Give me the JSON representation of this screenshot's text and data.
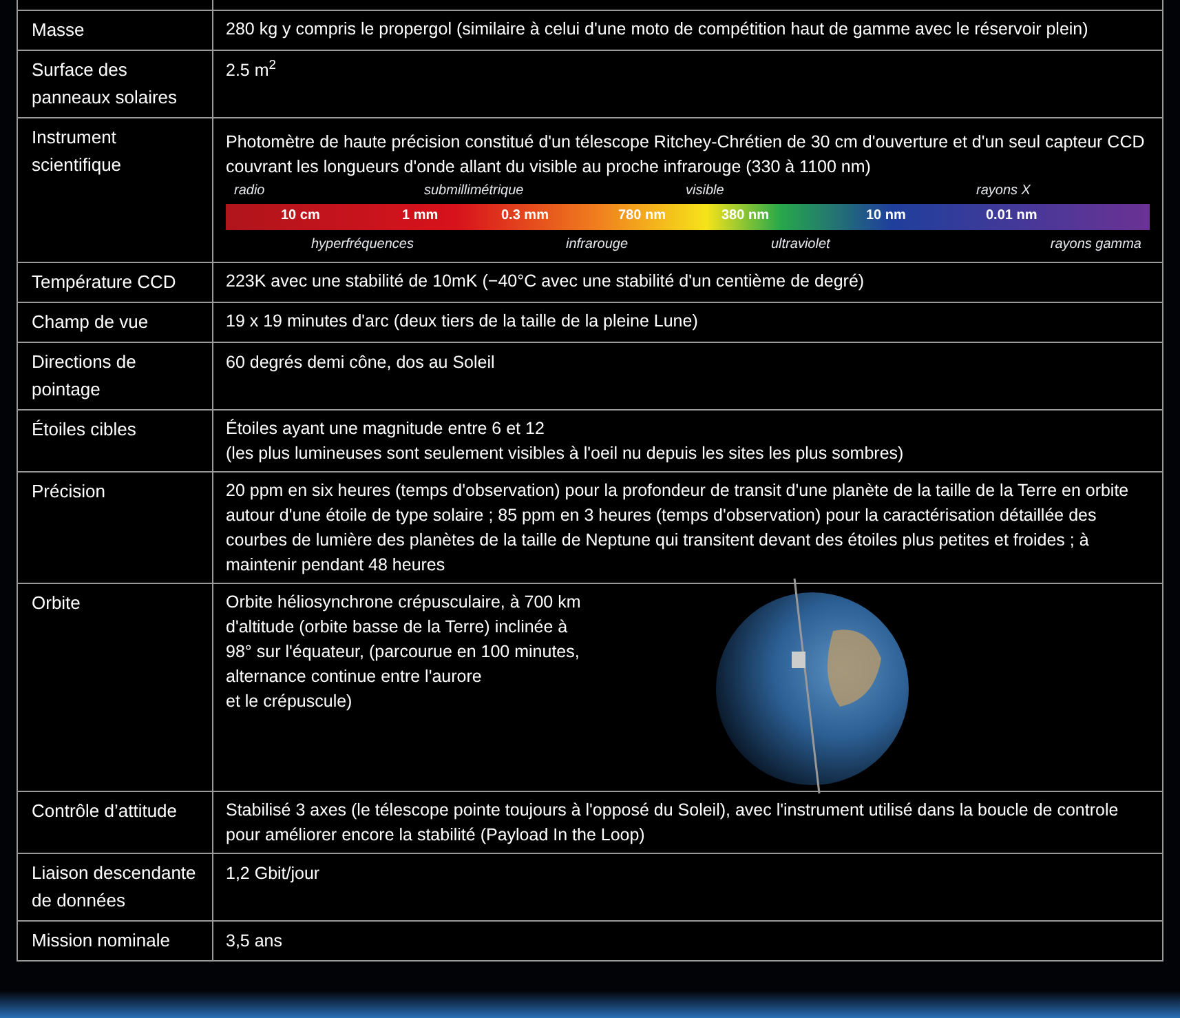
{
  "rows": [
    {
      "kind": "text",
      "label": "Masse",
      "lines": [
        "280 kg y compris le propergol (similaire à celui d'une moto de compétition haut de gamme avec le réservoir plein)"
      ]
    },
    {
      "kind": "text",
      "label": "Surface des panneaux solaires",
      "lines": [
        "2.5 m$^{2}$"
      ]
    },
    {
      "kind": "spectrum",
      "label": "Instrument scientifique",
      "lines": [
        "Photomètre de haute précision constitué d'un télescope Ritchey-Chrétien de 30 cm d'ouverture et d'un seul capteur CCD couvrant les longueurs d'onde allant du visible au proche infrarouge (330 à 1100 nm)"
      ],
      "spectrum": {
        "top_labels": [
          "radio",
          "submillimétrique",
          "visible",
          "rayons X"
        ],
        "bar_labels": [
          "10 cm",
          "1 mm",
          "0.3 mm",
          "780 nm",
          "380 nm",
          "10 nm",
          "0.01 nm"
        ],
        "bottom_labels": [
          "hyperfréquences",
          "infrarouge",
          "ultraviolet",
          "rayons gamma"
        ]
      }
    },
    {
      "kind": "text",
      "label": "Température CCD",
      "lines": [
        "223K avec une stabilité de 10mK (−40°C avec une stabilité d'un centième de degré)"
      ]
    },
    {
      "kind": "text",
      "label": "Champ de vue",
      "lines": [
        "19 x 19 minutes d'arc (deux tiers de la taille de la pleine Lune)"
      ]
    },
    {
      "kind": "text",
      "label": "Directions de pointage",
      "lines": [
        "60 degrés demi cône, dos au Soleil"
      ]
    },
    {
      "kind": "text",
      "label": "Étoiles cibles",
      "lines": [
        "Étoiles ayant une magnitude entre 6 et 12",
        "(les plus lumineuses sont seulement visibles à l'oeil nu depuis les sites les plus sombres)"
      ]
    },
    {
      "kind": "text",
      "label": "Précision",
      "lines": [
        "20 ppm en six heures (temps d'observation) pour la profondeur de transit d'une planète de la taille de la Terre en orbite autour d'une étoile de type solaire ; 85 ppm en 3 heures (temps d'observation) pour la caractérisation détaillée des courbes de lumière des planètes de la taille de Neptune qui transitent devant des étoiles plus petites et froides ; à maintenir pendant 48 heures"
      ]
    },
    {
      "kind": "image",
      "label": "Orbite",
      "lines": [
        "Orbite héliosynchrone crépusculaire, à 700 km",
        "d'altitude (orbite basse de la Terre) inclinée à",
        "98° sur l'équateur, (parcourue en 100 minutes,",
        "alternance continue entre l'aurore",
        "et le crépuscule)"
      ]
    },
    {
      "kind": "text",
      "label": "Contrôle d’attitude",
      "lines": [
        "Stabilisé 3 axes (le télescope pointe toujours à l'opposé du Soleil), avec l'instrument utilisé dans la boucle de controle pour améliorer encore la stabilité (Payload In the Loop)"
      ]
    },
    {
      "kind": "text",
      "label": "Liaison descendante de données",
      "lines": [
        "1,2 Gbit/jour"
      ]
    },
    {
      "kind": "text",
      "label": "Mission nominale",
      "lines": [
        "3,5 ans"
      ]
    }
  ]
}
